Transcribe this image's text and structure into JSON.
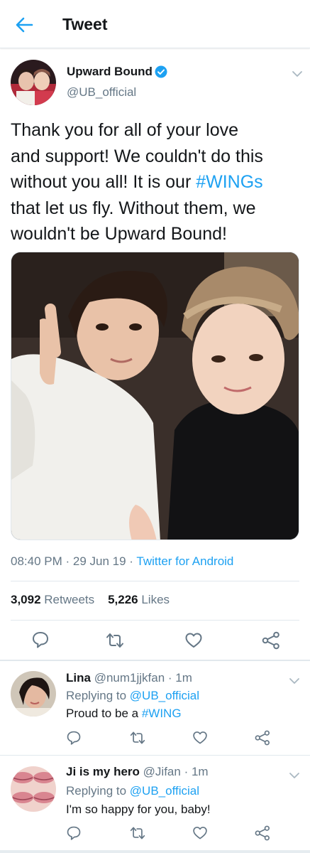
{
  "header": {
    "title": "Tweet"
  },
  "tweet": {
    "author_name": "Upward Bound",
    "author_handle": "@UB_official",
    "text_parts": [
      "Thank you for all of your love",
      "and support! We couldn't do this",
      "without you all! It is our ",
      "#WINGs",
      "that let us fly. Without them, we",
      "wouldn't be Upward Bound!"
    ],
    "time": "08:40 PM",
    "date": "29 Jun 19",
    "source": "Twitter for Android",
    "retweets_count": "3,092",
    "retweets_label": "Retweets",
    "likes_count": "5,226",
    "likes_label": "Likes"
  },
  "replies": [
    {
      "name": "Lina",
      "handle": "@num1jjkfan",
      "time": "1m",
      "replying_prefix": "Replying to ",
      "replying_to": "@UB_official",
      "text_before": "Proud to be a ",
      "hashtag": "#WING",
      "text_after": ""
    },
    {
      "name": "Ji is my hero",
      "handle": "@Jifan",
      "time": "1m",
      "replying_prefix": "Replying to ",
      "replying_to": "@UB_official",
      "text_before": "I'm so happy for you, baby!",
      "hashtag": "",
      "text_after": ""
    }
  ],
  "separators": {
    "meta_dot": " · ",
    "reply_dot": " · "
  },
  "colors": {
    "accent": "#1da1f2",
    "text": "#14171a",
    "secondary": "#657786",
    "divider": "#e1e8ed"
  },
  "icons": [
    "back-arrow-icon",
    "verified-badge-icon",
    "chevron-down-icon",
    "reply-icon",
    "retweet-icon",
    "like-icon",
    "share-icon"
  ]
}
